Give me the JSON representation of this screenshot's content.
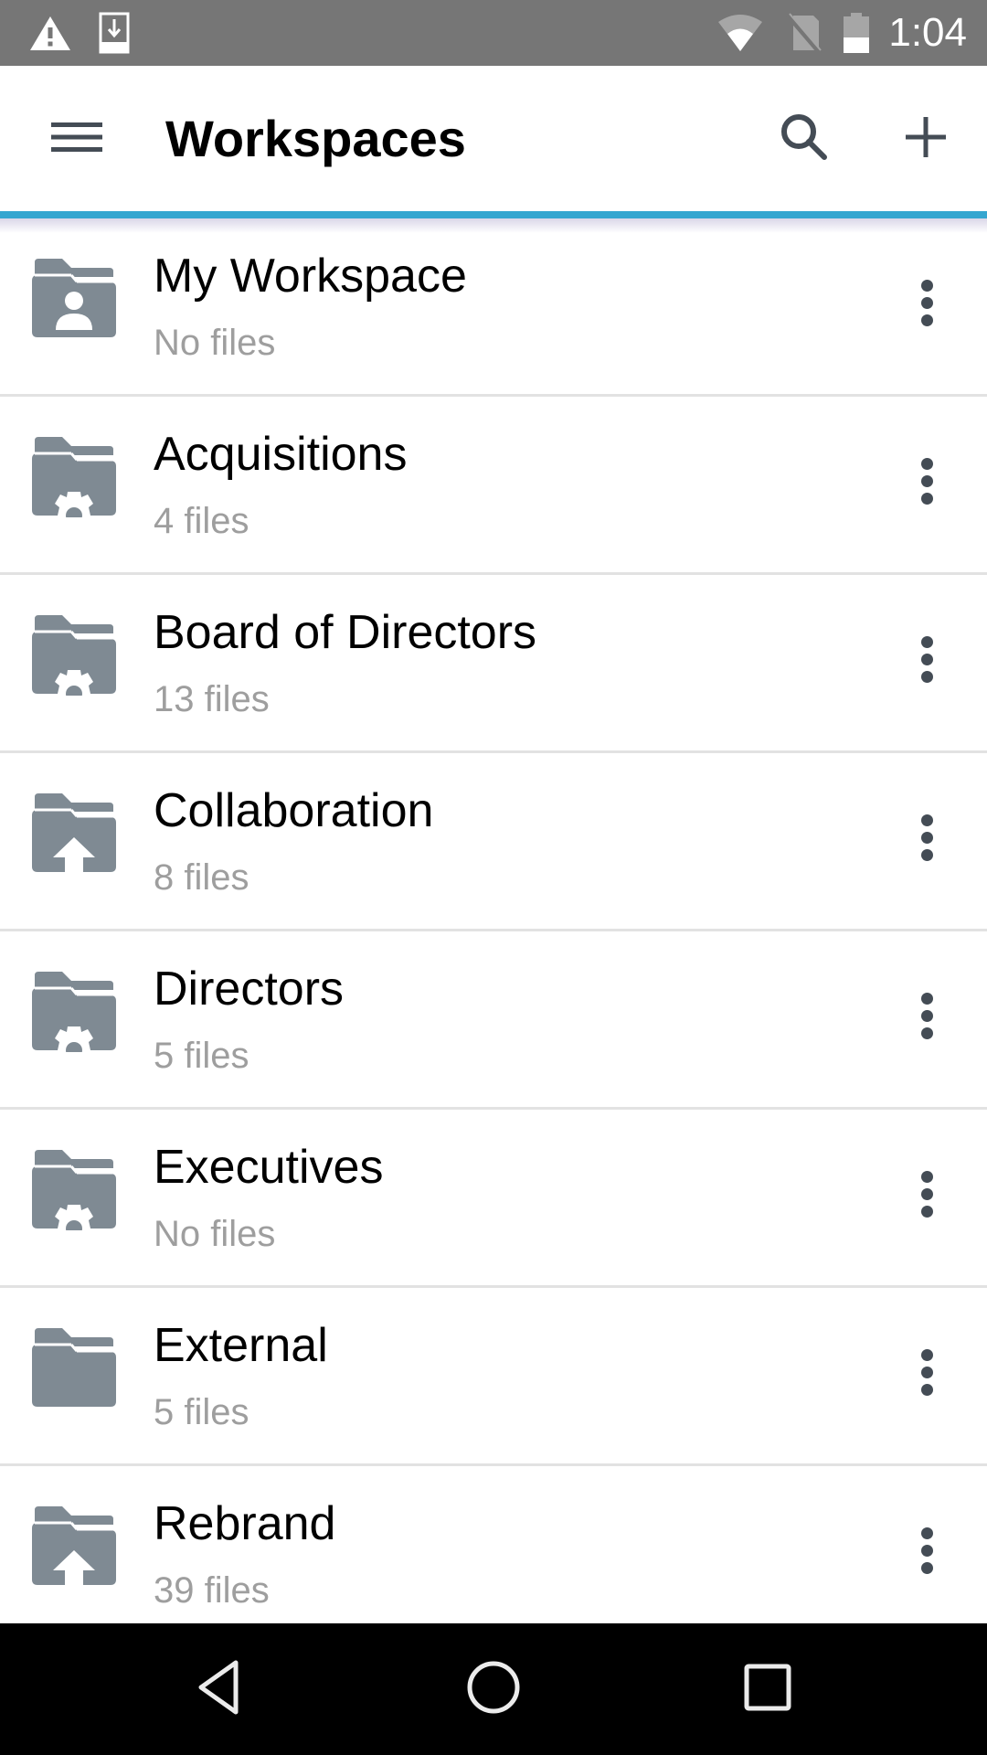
{
  "status_bar": {
    "time": "1:04",
    "left_icons": [
      "warning-icon",
      "download-icon"
    ],
    "right_icons": [
      "wifi-icon",
      "no-sim-icon",
      "battery-icon"
    ]
  },
  "app_bar": {
    "title": "Workspaces",
    "menu_icon": "hamburger-menu-icon",
    "search_icon": "search-icon",
    "add_icon": "plus-icon",
    "accent_color": "#35a6d0"
  },
  "workspaces": [
    {
      "name": "My Workspace",
      "count": "No files",
      "icon": "folder-user-icon"
    },
    {
      "name": "Acquisitions",
      "count": "4 files",
      "icon": "folder-gear-icon"
    },
    {
      "name": "Board of Directors",
      "count": "13 files",
      "icon": "folder-gear-icon"
    },
    {
      "name": "Collaboration",
      "count": "8 files",
      "icon": "folder-upload-icon"
    },
    {
      "name": "Directors",
      "count": "5 files",
      "icon": "folder-gear-icon"
    },
    {
      "name": "Executives",
      "count": "No files",
      "icon": "folder-gear-icon"
    },
    {
      "name": "External",
      "count": "5 files",
      "icon": "folder-icon"
    },
    {
      "name": "Rebrand",
      "count": "39 files",
      "icon": "folder-upload-icon"
    }
  ],
  "nav_bar": {
    "back_icon": "back-triangle-icon",
    "home_icon": "home-circle-icon",
    "recents_icon": "recents-square-icon"
  },
  "colors": {
    "status_bar": "#767676",
    "folder_icon": "#7f8a93",
    "action_icon": "#444c55",
    "subtitle": "#9e9e9e",
    "divider": "#e2e2e2"
  }
}
